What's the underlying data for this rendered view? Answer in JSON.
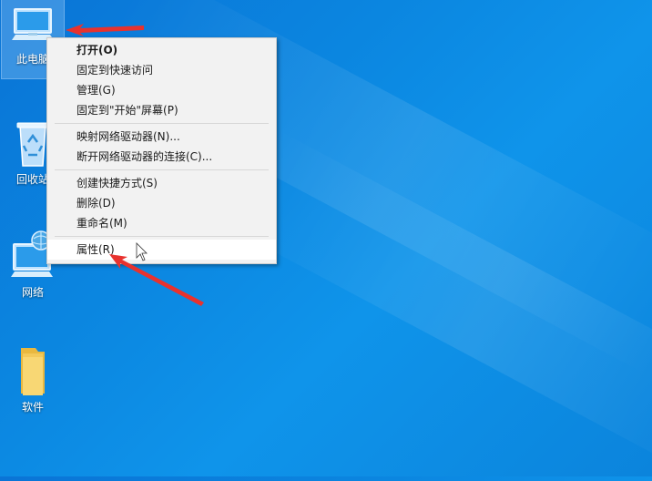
{
  "desktop": {
    "icons": [
      {
        "name": "this-pc",
        "label": "此电脑"
      },
      {
        "name": "recycle-bin",
        "label": "回收站"
      },
      {
        "name": "network",
        "label": "网络"
      },
      {
        "name": "software-folder",
        "label": "软件"
      }
    ]
  },
  "context_menu": {
    "groups": [
      {
        "items": [
          {
            "label": "打开(O)",
            "bold": true
          },
          {
            "label": "固定到快速访问"
          },
          {
            "label": "管理(G)"
          },
          {
            "label": "固定到\"开始\"屏幕(P)"
          }
        ]
      },
      {
        "items": [
          {
            "label": "映射网络驱动器(N)..."
          },
          {
            "label": "断开网络驱动器的连接(C)..."
          }
        ]
      },
      {
        "items": [
          {
            "label": "创建快捷方式(S)"
          },
          {
            "label": "删除(D)"
          },
          {
            "label": "重命名(M)"
          }
        ]
      },
      {
        "items": [
          {
            "label": "属性(R)",
            "hover": true
          }
        ]
      }
    ]
  },
  "colors": {
    "desktop_background": "#0b86e0",
    "menu_background": "#f2f2f2",
    "annotation_arrow": "#e8322e"
  }
}
